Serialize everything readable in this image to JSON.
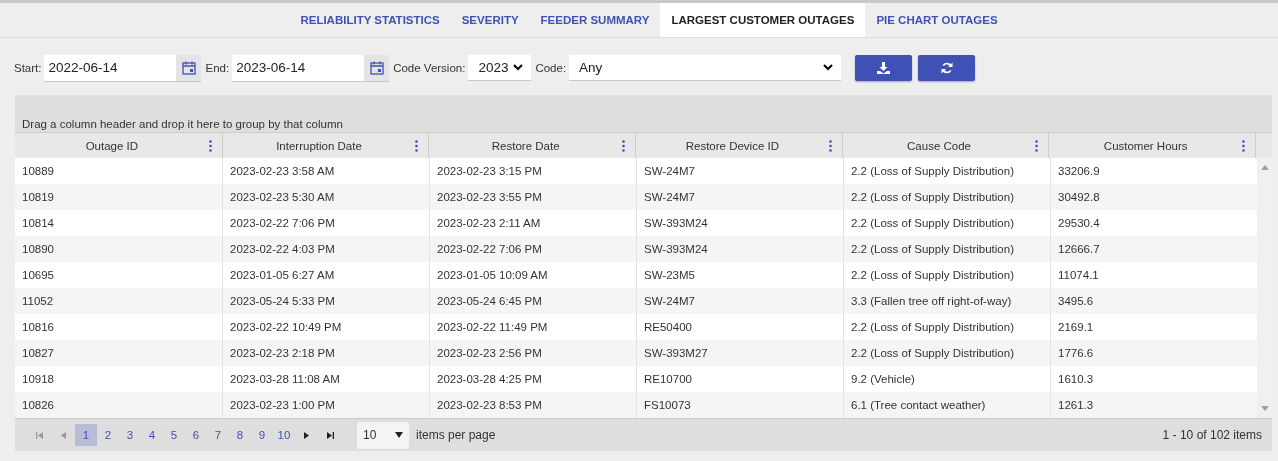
{
  "tabs": [
    {
      "label": "RELIABILITY STATISTICS",
      "selected": false
    },
    {
      "label": "SEVERITY",
      "selected": false
    },
    {
      "label": "FEEDER SUMMARY",
      "selected": false
    },
    {
      "label": "LARGEST CUSTOMER OUTAGES",
      "selected": true
    },
    {
      "label": "PIE CHART OUTAGES",
      "selected": false
    }
  ],
  "filters": {
    "start_label": "Start:",
    "start_value": "2022-06-14",
    "end_label": "End:",
    "end_value": "2023-06-14",
    "code_version_label": "Code Version:",
    "code_version_value": "2023",
    "code_label": "Code:",
    "code_value": "Any"
  },
  "grid": {
    "group_hint": "Drag a column header and drop it here to group by that column",
    "columns": [
      "Outage ID",
      "Interruption Date",
      "Restore Date",
      "Restore Device ID",
      "Cause Code",
      "Customer Hours"
    ],
    "rows": [
      [
        "10889",
        "2023-02-23 3:58 AM",
        "2023-02-23 3:15 PM",
        "SW-24M7",
        "2.2 (Loss of Supply Distribution)",
        "33206.9"
      ],
      [
        "10819",
        "2023-02-23 5:30 AM",
        "2023-02-23 3:55 PM",
        "SW-24M7",
        "2.2 (Loss of Supply Distribution)",
        "30492.8"
      ],
      [
        "10814",
        "2023-02-22 7:06 PM",
        "2023-02-23 2:11 AM",
        "SW-393M24",
        "2.2 (Loss of Supply Distribution)",
        "29530.4"
      ],
      [
        "10890",
        "2023-02-22 4:03 PM",
        "2023-02-22 7:06 PM",
        "SW-393M24",
        "2.2 (Loss of Supply Distribution)",
        "12666.7"
      ],
      [
        "10695",
        "2023-01-05 6:27 AM",
        "2023-01-05 10:09 AM",
        "SW-23M5",
        "2.2 (Loss of Supply Distribution)",
        "11074.1"
      ],
      [
        "11052",
        "2023-05-24 5:33 PM",
        "2023-05-24 6:45 PM",
        "SW-24M7",
        "3.3 (Fallen tree off right-of-way)",
        "3495.6"
      ],
      [
        "10816",
        "2023-02-22 10:49 PM",
        "2023-02-22 11:49 PM",
        "RE50400",
        "2.2 (Loss of Supply Distribution)",
        "2169.1"
      ],
      [
        "10827",
        "2023-02-23 2:18 PM",
        "2023-02-23 2:56 PM",
        "SW-393M27",
        "2.2 (Loss of Supply Distribution)",
        "1776.6"
      ],
      [
        "10918",
        "2023-03-28 11:08 AM",
        "2023-03-28 4:25 PM",
        "RE10700",
        "9.2 (Vehicle)",
        "1610.3"
      ],
      [
        "10826",
        "2023-02-23 1:00 PM",
        "2023-02-23 8:53 PM",
        "FS10073",
        "6.1 (Tree contact weather)",
        "1261.3"
      ]
    ]
  },
  "pager": {
    "pages": [
      {
        "label": "1",
        "selected": true
      },
      {
        "label": "2",
        "selected": false
      },
      {
        "label": "3",
        "selected": false
      },
      {
        "label": "4",
        "selected": false
      },
      {
        "label": "5",
        "selected": false
      },
      {
        "label": "6",
        "selected": false
      },
      {
        "label": "7",
        "selected": false
      },
      {
        "label": "8",
        "selected": false
      },
      {
        "label": "9",
        "selected": false
      },
      {
        "label": "10",
        "selected": false
      }
    ],
    "page_size": "10",
    "page_size_label": "items per page",
    "summary": "1 - 10 of 102 items"
  }
}
